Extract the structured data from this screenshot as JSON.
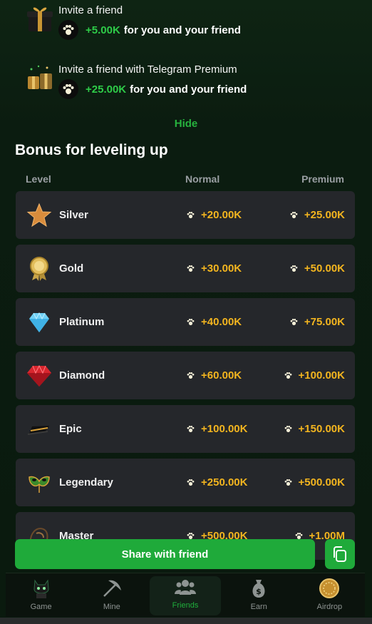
{
  "invites": [
    {
      "title": "Invite a friend",
      "amount": "+5.00K",
      "text": "for you and your friend"
    },
    {
      "title": "Invite a friend with Telegram Premium",
      "amount": "+25.00K",
      "text": "for you and your friend"
    }
  ],
  "hide_label": "Hide",
  "section_title": "Bonus for leveling up",
  "columns": {
    "level": "Level",
    "normal": "Normal",
    "premium": "Premium"
  },
  "levels": [
    {
      "name": "Silver",
      "normal": "+20.00K",
      "premium": "+25.00K",
      "icon": "star-icon"
    },
    {
      "name": "Gold",
      "normal": "+30.00K",
      "premium": "+50.00K",
      "icon": "medal-icon"
    },
    {
      "name": "Platinum",
      "normal": "+40.00K",
      "premium": "+75.00K",
      "icon": "diamond-icon"
    },
    {
      "name": "Diamond",
      "normal": "+60.00K",
      "premium": "+100.00K",
      "icon": "ruby-icon"
    },
    {
      "name": "Epic",
      "normal": "+100.00K",
      "premium": "+150.00K",
      "icon": "hat-icon"
    },
    {
      "name": "Legendary",
      "normal": "+250.00K",
      "premium": "+500.00K",
      "icon": "mask-icon"
    },
    {
      "name": "Master",
      "normal": "+500.00K",
      "premium": "+1.00M",
      "icon": "helmet-icon"
    }
  ],
  "share_label": "Share with friend",
  "nav": [
    {
      "label": "Game",
      "icon": "cat-icon"
    },
    {
      "label": "Mine",
      "icon": "pickaxe-icon"
    },
    {
      "label": "Friends",
      "icon": "friends-icon"
    },
    {
      "label": "Earn",
      "icon": "money-bag-icon"
    },
    {
      "label": "Airdrop",
      "icon": "coin-icon"
    }
  ],
  "colors": {
    "accent": "#1faa3a",
    "amount": "#f3b51f",
    "green_text": "#2ecc48",
    "card": "#25272b"
  }
}
